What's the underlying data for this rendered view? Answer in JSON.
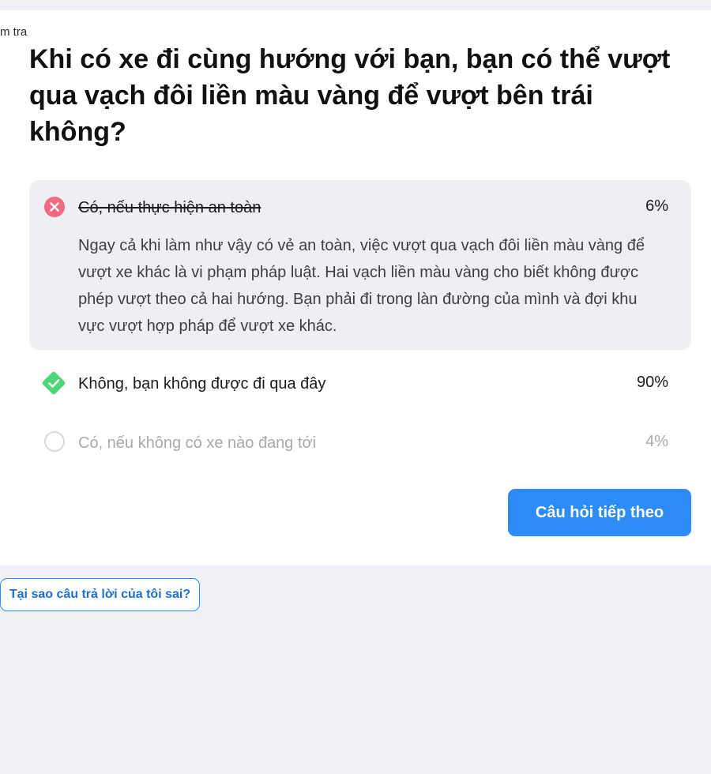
{
  "breadcrumb": "m tra",
  "question": "Khi có xe đi cùng hướng với bạn, bạn có thể vượt qua vạch đôi liền màu vàng để vượt bên trái không?",
  "options": [
    {
      "label": "Có, nếu thực hiện an toàn",
      "percent": "6%",
      "state": "wrong",
      "icon": "x-circle-icon",
      "explanation": "Ngay cả khi làm như vậy có vẻ an toàn, việc vượt qua vạch đôi liền màu vàng để vượt xe khác là vi phạm pháp luật. Hai vạch liền màu vàng cho biết không được phép vượt theo cả hai hướng. Bạn phải đi trong làn đường của mình và đợi khu vực vượt hợp pháp để vượt xe khác."
    },
    {
      "label": "Không, bạn không được đi qua đây",
      "percent": "90%",
      "state": "correct",
      "icon": "check-diamond-icon"
    },
    {
      "label": "Có, nếu không có xe nào đang tới",
      "percent": "4%",
      "state": "unselected",
      "icon": "empty-radio-icon"
    }
  ],
  "buttons": {
    "next": "Câu hỏi tiếp theo",
    "why_wrong": "Tại sao câu trả lời của tôi sai?"
  },
  "colors": {
    "wrong": "#f06b7f",
    "correct": "#4fd67a",
    "accent": "#2d8cf5",
    "page_bg": "#eff0f5"
  }
}
